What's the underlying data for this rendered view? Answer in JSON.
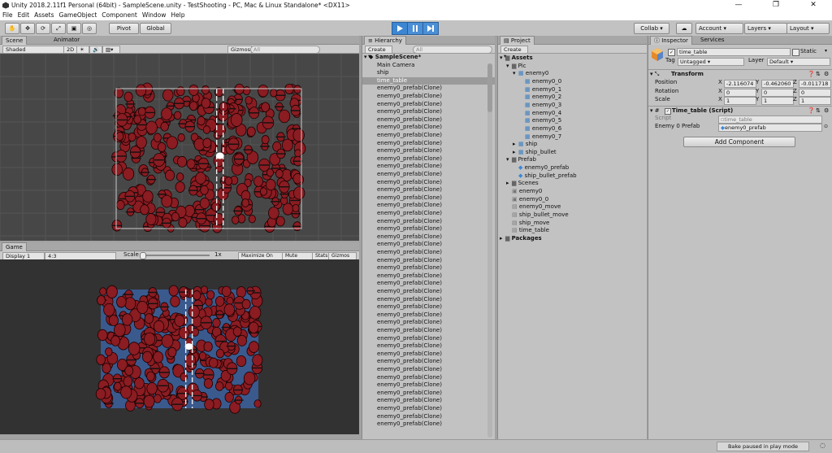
{
  "window": {
    "title": "Unity 2018.2.11f1 Personal (64bit) - SampleScene.unity - TestShooting - PC, Mac & Linux Standalone* <DX11>",
    "minimize": "—",
    "maximize": "❐",
    "close": "✕"
  },
  "menu": [
    "File",
    "Edit",
    "Assets",
    "GameObject",
    "Component",
    "Window",
    "Help"
  ],
  "toolbar": {
    "pivot": "Pivot",
    "global": "Global",
    "collab": "Collab ▾",
    "account": "Account",
    "layers": "Layers",
    "layout": "Layout"
  },
  "scene": {
    "tabs": [
      "Scene",
      "Animator"
    ],
    "shading": "Shaded",
    "mode2d": "2D",
    "gizmos": "Gizmos ▾",
    "search_placeholder": "All"
  },
  "game": {
    "tab": "Game",
    "display": "Display 1",
    "aspect": "4:3",
    "scale_label": "Scale",
    "scale_value": "1x",
    "maximize": "Maximize On Play",
    "mute": "Mute Audio",
    "stats": "Stats",
    "gizmos": "Gizmos ▾"
  },
  "hierarchy": {
    "tab": "Hierarchy",
    "create": "Create ▾",
    "search_placeholder": "All",
    "scene": "SampleScene*",
    "items": [
      "Main Camera",
      "ship",
      "time_table"
    ],
    "selected": "time_table",
    "clone_label": "enemy0_prefab(Clone)",
    "clone_count_visible": 44
  },
  "project": {
    "tab": "Project",
    "create": "Create ▾",
    "tree": [
      {
        "label": "Assets",
        "depth": 0,
        "kind": "folder",
        "open": true,
        "bold": true
      },
      {
        "label": "Pic",
        "depth": 1,
        "kind": "folder",
        "open": true
      },
      {
        "label": "enemy0",
        "depth": 2,
        "kind": "sprite",
        "open": true
      },
      {
        "label": "enemy0_0",
        "depth": 3,
        "kind": "sprite"
      },
      {
        "label": "enemy0_1",
        "depth": 3,
        "kind": "sprite"
      },
      {
        "label": "enemy0_2",
        "depth": 3,
        "kind": "sprite"
      },
      {
        "label": "enemy0_3",
        "depth": 3,
        "kind": "sprite"
      },
      {
        "label": "enemy0_4",
        "depth": 3,
        "kind": "sprite"
      },
      {
        "label": "enemy0_5",
        "depth": 3,
        "kind": "sprite"
      },
      {
        "label": "enemy0_6",
        "depth": 3,
        "kind": "sprite"
      },
      {
        "label": "enemy0_7",
        "depth": 3,
        "kind": "sprite"
      },
      {
        "label": "ship",
        "depth": 2,
        "kind": "sprite",
        "closed": true
      },
      {
        "label": "ship_bullet",
        "depth": 2,
        "kind": "sprite",
        "closed": true
      },
      {
        "label": "Prefab",
        "depth": 1,
        "kind": "folder",
        "open": true
      },
      {
        "label": "enemy0_prefab",
        "depth": 2,
        "kind": "prefab"
      },
      {
        "label": "ship_bullet_prefab",
        "depth": 2,
        "kind": "prefab"
      },
      {
        "label": "Scenes",
        "depth": 1,
        "kind": "folder",
        "closed": true
      },
      {
        "label": "enemy0",
        "depth": 1,
        "kind": "anim"
      },
      {
        "label": "enemy0_0",
        "depth": 1,
        "kind": "anim"
      },
      {
        "label": "enemy0_move",
        "depth": 1,
        "kind": "script"
      },
      {
        "label": "ship_bullet_move",
        "depth": 1,
        "kind": "script"
      },
      {
        "label": "ship_move",
        "depth": 1,
        "kind": "script"
      },
      {
        "label": "time_table",
        "depth": 1,
        "kind": "script"
      },
      {
        "label": "Packages",
        "depth": 0,
        "kind": "folder",
        "closed": true,
        "bold": true
      }
    ]
  },
  "inspector": {
    "tabs": [
      "Inspector",
      "Services"
    ],
    "object_name": "time_table",
    "static": "Static",
    "tag_label": "Tag",
    "tag_value": "Untagged",
    "layer_label": "Layer",
    "layer_value": "Default",
    "transform": {
      "title": "Transform",
      "rows": [
        {
          "label": "Position",
          "x": "-2.116074",
          "y": "-0.462060",
          "z": "-0.011718"
        },
        {
          "label": "Rotation",
          "x": "0",
          "y": "0",
          "z": "0"
        },
        {
          "label": "Scale",
          "x": "1",
          "y": "1",
          "z": "1"
        }
      ]
    },
    "script_component": {
      "title": "Time_table (Script)",
      "script_label": "Script",
      "script_value": "time_table",
      "prefab_label": "Enemy 0 Prefab",
      "prefab_value": "enemy0_prefab"
    },
    "add_component": "Add Component"
  },
  "status": "Bake paused in play mode",
  "colors": {
    "accent": "#3c86d2",
    "enemy": "#8a1c22",
    "game_bg": "#3a5a8e",
    "scene_bg": "#474747"
  }
}
